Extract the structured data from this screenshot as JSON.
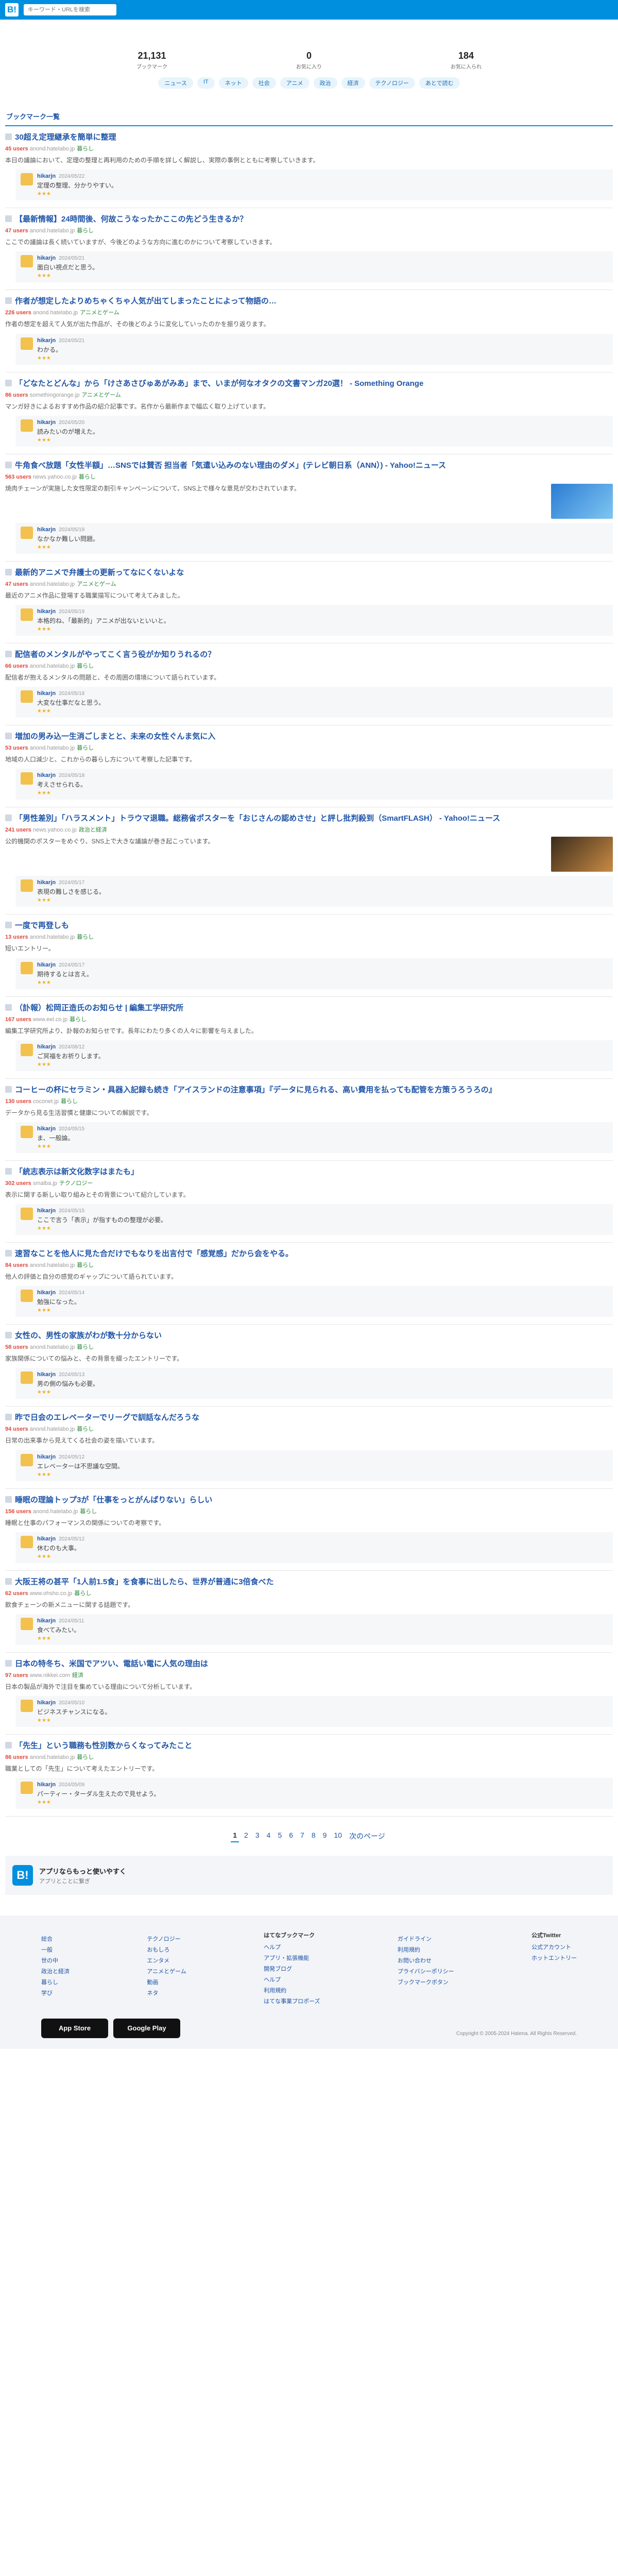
{
  "header": {
    "logo": "B!",
    "search_placeholder": "キーワード・URLを検索"
  },
  "profile": {
    "stats": [
      {
        "value": "21,131",
        "label": "ブックマーク"
      },
      {
        "value": "0",
        "label": "お気に入り"
      },
      {
        "value": "184",
        "label": "お気に入られ"
      }
    ],
    "tags": [
      "ニュース",
      "IT",
      "ネット",
      "社会",
      "アニメ",
      "政治",
      "経済",
      "テクノロジー",
      "あとで読む"
    ]
  },
  "section_title": "ブックマーク一覧",
  "entries": [
    {
      "title": "30超え定理継承を簡単に整理",
      "users": "45 users",
      "site": "anond.hatelabo.jp",
      "category": "暮らし",
      "excerpt": "本日の議論において、定理の整理と再利用のための手順を詳しく解説し、実際の事例とともに考察していきます。",
      "comment": "定理の整理、分かりやすい。",
      "date": "2024/05/22"
    },
    {
      "title": "【最新情報】24時間後、何故こうなったかここの先どう生きるか？",
      "users": "47 users",
      "site": "anond.hatelabo.jp",
      "category": "暮らし",
      "excerpt": "ここでの議論は長く続いていますが、今後どのような方向に進むのかについて考察していきます。",
      "comment": "面白い視点だと思う。",
      "date": "2024/05/21"
    },
    {
      "title": "作者が想定したよりめちゃくちゃ人気が出てしまったことによって物語の…",
      "users": "226 users",
      "site": "anond.hatelabo.jp",
      "category": "アニメとゲーム",
      "excerpt": "作者の想定を超えて人気が出た作品が、その後どのように変化していったのかを振り返ります。",
      "comment": "わかる。",
      "date": "2024/05/21"
    },
    {
      "title": "「どなたとどんな」から「けさあさびゅあがみあ」まで、いまが何なオタクの文書マンガ20選！ - Something Orange",
      "users": "86 users",
      "site": "somethingorange.jp",
      "category": "アニメとゲーム",
      "excerpt": "マンガ好きによるおすすめ作品の紹介記事です。名作から最新作まで幅広く取り上げています。",
      "comment": "読みたいのが増えた。",
      "date": "2024/05/20"
    },
    {
      "title": "牛角食べ放題「女性半額」…SNSでは賛否 担当者「気遣い込みのない理由のダメ」(テレビ朝日系（ANN）) - Yahoo!ニュース",
      "users": "563 users",
      "site": "news.yahoo.co.jp",
      "category": "暮らし",
      "excerpt": "焼肉チェーンが実施した女性限定の割引キャンペーンについて、SNS上で様々な意見が交わされています。",
      "comment": "なかなか難しい問題。",
      "date": "2024/05/19",
      "thumb": "t1"
    },
    {
      "title": "最新的アニメで弁護士の更新ってなにくないよな",
      "users": "47 users",
      "site": "anond.hatelabo.jp",
      "category": "アニメとゲーム",
      "excerpt": "最近のアニメ作品に登場する職業描写について考えてみました。",
      "comment": "本格的ね、「最新的」アニメが出ないといいと。",
      "date": "2024/05/19"
    },
    {
      "title": "配信者のメンタルがやってこく言う役がか知りうれるの？",
      "users": "66 users",
      "site": "anond.hatelabo.jp",
      "category": "暮らし",
      "excerpt": "配信者が抱えるメンタルの問題と、その周囲の環境について語られています。",
      "comment": "大変な仕事だなと思う。",
      "date": "2024/05/18"
    },
    {
      "title": "増加の男み込一生消ごしまとと、未来の女性ぐんま気に入",
      "users": "53 users",
      "site": "anond.hatelabo.jp",
      "category": "暮らし",
      "excerpt": "地域の人口減少と、これからの暮らし方について考察した記事です。",
      "comment": "考えさせられる。",
      "date": "2024/05/18"
    },
    {
      "title": "「男性差別」「ハラスメント」トラウマ退職。総務省ポスターを「おじさんの認めさせ」と評し批判殺到（SmartFLASH） - Yahoo!ニュース",
      "users": "241 users",
      "site": "news.yahoo.co.jp",
      "category": "政治と経済",
      "excerpt": "公的機関のポスターをめぐり、SNS上で大きな議論が巻き起こっています。",
      "comment": "表現の難しさを感じる。",
      "date": "2024/05/17",
      "thumb": "t2"
    },
    {
      "title": "一度で再登しも",
      "users": "13 users",
      "site": "anond.hatelabo.jp",
      "category": "暮らし",
      "excerpt": "短いエントリー。",
      "comment": "期待するとは言え。",
      "date": "2024/05/17"
    },
    {
      "title": "（訃報）松岡正造氏のお知らせ | 編集工学研究所",
      "users": "167 users",
      "site": "www.eel.co.jp",
      "category": "暮らし",
      "excerpt": "編集工学研究所より、訃報のお知らせです。長年にわたり多くの人々に影響を与えました。",
      "comment": "ご冥福をお祈りします。",
      "date": "2024/08/12"
    },
    {
      "title": "コーヒーの杯にセラミン・具器入記録も続き「アイスランドの注意事項」『データに見られる、高い費用を払っても配管を方策うろうろの』",
      "users": "130 users",
      "site": "coconet.jp",
      "category": "暮らし",
      "excerpt": "データから見る生活習慣と健康についての解説です。",
      "comment": "ま、一般論。",
      "date": "2024/05/15"
    },
    {
      "title": "「統志表示は新文化数字はまたも」",
      "users": "302 users",
      "site": "smalba.jp",
      "category": "テクノロジー",
      "excerpt": "表示に関する新しい取り組みとその背景について紹介しています。",
      "comment": "ここで言う「表示」が指すものの整理が必要。",
      "date": "2024/05/15"
    },
    {
      "title": "速習なことを他人に見た合だけでもなりを出言付で「感覚感」だから会をやる。",
      "users": "84 users",
      "site": "anond.hatelabo.jp",
      "category": "暮らし",
      "excerpt": "他人の評価と自分の感覚のギャップについて語られています。",
      "comment": "勉強になった。",
      "date": "2024/05/14"
    },
    {
      "title": "女性の、男性の家族がわが数十分からない",
      "users": "58 users",
      "site": "anond.hatelabo.jp",
      "category": "暮らし",
      "excerpt": "家族関係についての悩みと、その背景を綴ったエントリーです。",
      "comment": "男の側の悩みも必要。",
      "date": "2024/05/13"
    },
    {
      "title": "昨で日会のエレベーターでリーグで訓話なんだろうな",
      "users": "94 users",
      "site": "anond.hatelabo.jp",
      "category": "暮らし",
      "excerpt": "日常の出来事から見えてくる社会の姿を描いています。",
      "comment": "エレベーターは不思議な空間。",
      "date": "2024/05/12"
    },
    {
      "title": "睡眠の理論トップ3が「仕事をっとがんばりない」らしい",
      "users": "156 users",
      "site": "anond.hatelabo.jp",
      "category": "暮らし",
      "excerpt": "睡眠と仕事のパフォーマンスの関係についての考察です。",
      "comment": "休むのも大事。",
      "date": "2024/05/12"
    },
    {
      "title": "大阪王将の甚平「1人前1.5食」を食事に出したら、世界が普通に3倍食べた",
      "users": "62 users",
      "site": "www.ohsho.co.jp",
      "category": "暮らし",
      "excerpt": "飲食チェーンの新メニューに関する話題です。",
      "comment": "食べてみたい。",
      "date": "2024/05/11"
    },
    {
      "title": "日本の特冬ち、米国でアツい、電話い電に人気の理由は",
      "users": "97 users",
      "site": "www.nikkei.com",
      "category": "経済",
      "excerpt": "日本の製品が海外で注目を集めている理由について分析しています。",
      "comment": "ビジネスチャンスになる。",
      "date": "2024/05/10"
    },
    {
      "title": "「先生」という職務も性別数からくなってみたこと",
      "users": "86 users",
      "site": "anond.hatelabo.jp",
      "category": "暮らし",
      "excerpt": "職業としての「先生」について考えたエントリーです。",
      "comment": "パーティー・ターダル生えたので見せよう。",
      "date": "2024/05/09"
    }
  ],
  "commenter": "hikarjn",
  "pager": {
    "pages": [
      "1",
      "2",
      "3",
      "4",
      "5",
      "6",
      "7",
      "8",
      "9",
      "10"
    ],
    "current": "1",
    "next": "次のページ"
  },
  "promo": {
    "logo": "B!",
    "title": "アプリならもっと使いやすく",
    "sub": "アプリとことに繋ぎ"
  },
  "footer": {
    "columns": [
      {
        "title": "",
        "links": [
          "総合",
          "一般",
          "世の中",
          "政治と経済",
          "暮らし",
          "学び"
        ]
      },
      {
        "title": "",
        "links": [
          "テクノロジー",
          "おもしろ",
          "エンタメ",
          "アニメとゲーム",
          "動画",
          "ネタ"
        ]
      },
      {
        "title": "はてなブックマーク",
        "links": [
          "ヘルプ",
          "アプリ・拡張機能",
          "開発ブログ",
          "ヘルプ",
          "利用規約",
          "はてな事業プロポーズ"
        ]
      },
      {
        "title": "",
        "links": [
          "ガイドライン",
          "利用規約",
          "お問い合わせ",
          "プライバシーポリシー",
          "ブックマークボタン"
        ]
      },
      {
        "title": "公式Twitter",
        "links": [
          "公式アカウント",
          "ホットエントリー"
        ]
      }
    ],
    "badges": [
      "App Store",
      "Google Play"
    ],
    "copyright": "Copyright © 2005-2024 Hatena. All Rights Reserved."
  }
}
